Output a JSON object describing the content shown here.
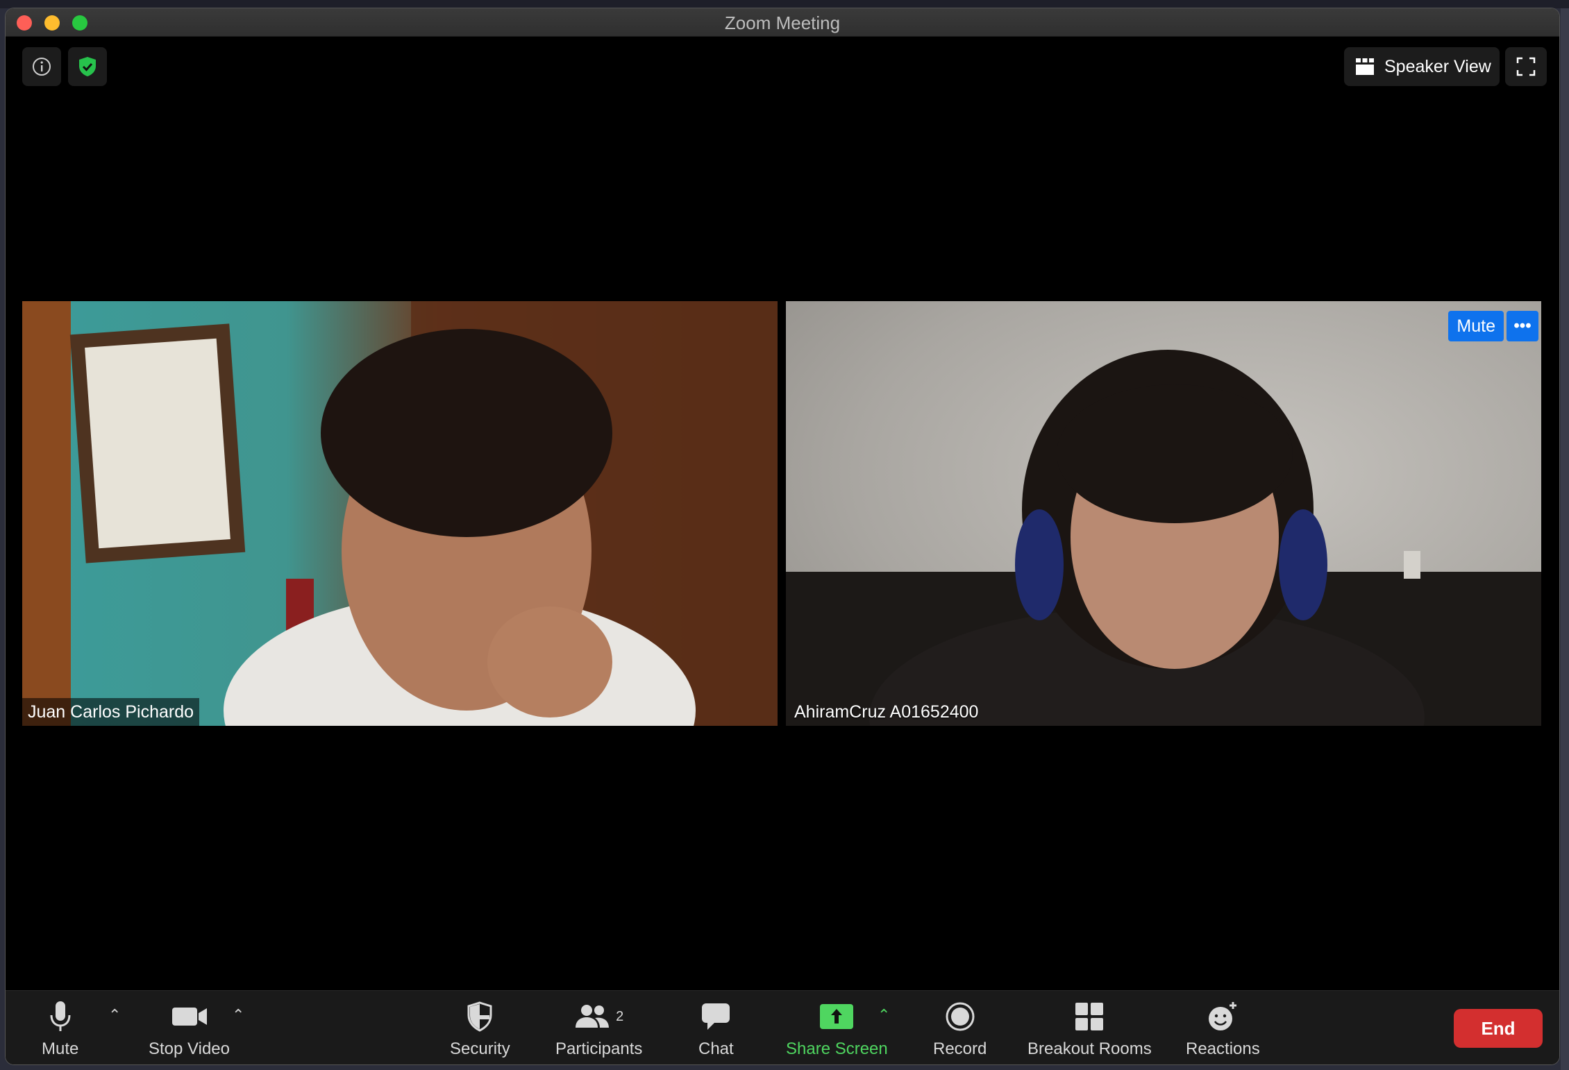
{
  "window": {
    "title": "Zoom Meeting"
  },
  "topbar": {
    "view_label": "Speaker View"
  },
  "tiles": [
    {
      "name": "Juan Carlos Pichardo"
    },
    {
      "name": "AhiramCruz A01652400",
      "mute_label": "Mute",
      "more_label": "•••"
    }
  ],
  "toolbar": {
    "mute": "Mute",
    "stop_video": "Stop Video",
    "security": "Security",
    "participants": "Participants",
    "participants_count": "2",
    "chat": "Chat",
    "share_screen": "Share Screen",
    "record": "Record",
    "breakout_rooms": "Breakout Rooms",
    "reactions": "Reactions",
    "end": "End"
  },
  "colors": {
    "accent_blue": "#0e72ed",
    "share_green": "#4fd660",
    "end_red": "#d32f2f",
    "shield_green": "#27c24c"
  }
}
